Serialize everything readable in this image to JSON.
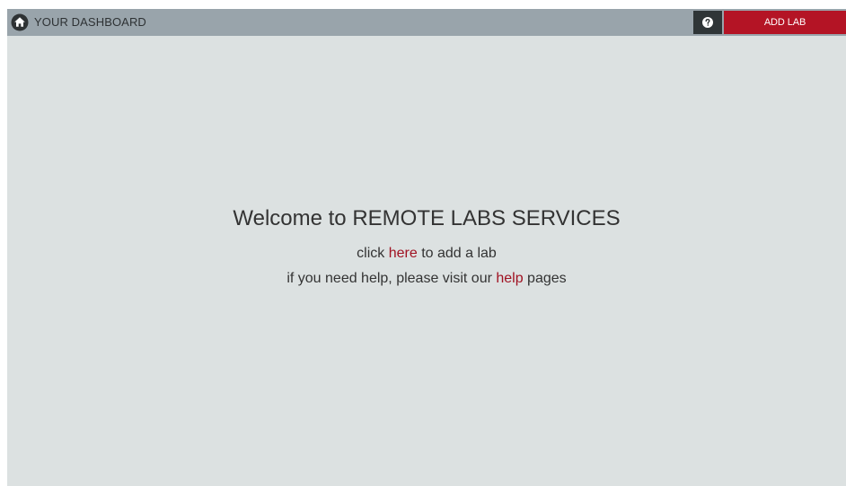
{
  "header": {
    "title": "YOUR DASHBOARD",
    "home_icon": "home-icon",
    "help_icon": "question-circle-icon",
    "add_lab_label": "ADD LAB"
  },
  "main": {
    "welcome_title": "Welcome to REMOTE LABS SERVICES",
    "line1": {
      "prefix": "click ",
      "link": "here",
      "suffix": " to add a lab"
    },
    "line2": {
      "prefix": "if you need help, please visit our ",
      "link": "help",
      "suffix": " pages"
    }
  },
  "colors": {
    "topbar": "#99a4ab",
    "background": "#dce1e1",
    "accent": "#b41425",
    "help_button": "#2f3537",
    "link": "#a01222"
  }
}
